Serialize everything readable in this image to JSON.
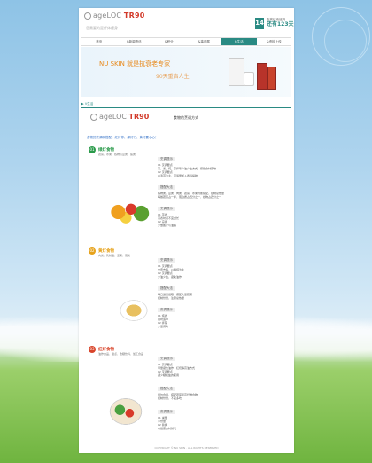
{
  "brand": {
    "logo_text": "ageLOC",
    "logo_tr": "TR90",
    "tagline": "您需要的是纤体瘦身"
  },
  "day_counter": {
    "day": "14",
    "label": "距离结束还剩",
    "remaining": "还有123天"
  },
  "nav": {
    "items": [
      {
        "label": "首页"
      },
      {
        "label": "&新闻资讯"
      },
      {
        "label": "&积分"
      },
      {
        "label": "&事迹展"
      },
      {
        "label": "&生活"
      },
      {
        "label": "&资料上传"
      }
    ],
    "active_index": 4
  },
  "banner": {
    "headline": "NU SKIN 就是抗衰老专家",
    "subline": "90天重启人生"
  },
  "breadcrumb": {
    "text": "V生活"
  },
  "content": {
    "title_logo": "ageLOC",
    "title_tr": "TR90",
    "heading": "食物的烹调方式",
    "intro": "食物的烹调和搭配，红灯停、绿灯行、黄灯要小心！",
    "sections": [
      {
        "num": "01",
        "title": "绿灯食物",
        "desc": "蔬菜、水果、谷物与豆类、鱼类",
        "color": "#2a9a4a",
        "col1_tag": "烹调提示",
        "col1_lines": [
          "01 烹调要点",
          "蒸、煮、炖、凉拌等少油少盐方式，保留食材原味",
          "02 烹调要点",
          "以清蒸为主、可适量加入香料提味"
        ],
        "col2_tag": "搭配大法",
        "col2_lines": [
          "谷物类、豆类、肉类、蔬菜、水果均衡搭配，控制总热量",
          "每餐蔬菜占一半、蛋白质占四分之一、谷物占四分之一"
        ],
        "col3_tag": "烹调提示",
        "col3_lines": [
          "01 蒸煮",
          "蒸煮时间不宜过长",
          "02 凉拌",
          "少放酱汁与油脂"
        ]
      },
      {
        "num": "02",
        "title": "黄灯食物",
        "desc": "肉类、乳制品、坚果、蛋类",
        "color": "#e6a21a",
        "col1_tag": "烹调提示",
        "col1_lines": [
          "01 烹调要点",
          "去皮去脂、以烤炖为主",
          "02 烹调要点",
          "少油少盐，避免油炸"
        ],
        "col2_tag": "搭配大法",
        "col2_lines": [
          "每日适量摄取，搭配大量蔬菜",
          "控制份量，注意总热量"
        ],
        "col3_tag": "烹调提示",
        "col3_lines": [
          "01 炖煮",
          "用时适中",
          "02 拌菜",
          "少量调味"
        ]
      },
      {
        "num": "03",
        "title": "红灯食物",
        "desc": "油炸食品、甜点、含糖饮料、加工食品",
        "color": "#d8442a",
        "col1_tag": "烹调提示",
        "col1_lines": [
          "01 烹调要点",
          "尽量避免油炸、红烧等高油方式",
          "02 烹调要点",
          "减少糖和盐的使用"
        ],
        "col2_tag": "搭配大法",
        "col2_lines": [
          "偶尔食用，搭配蔬菜和高纤维食物",
          "控制份量，不宜多吃"
        ],
        "col3_tag": "烹调提示",
        "col3_lines": [
          "01 减量",
          "小份量",
          "02 替换",
          "以健康食材替代"
        ]
      }
    ]
  },
  "footer": {
    "text": "COPYRIGHT © NU SKIN · ALL RIGHTS RESERVED"
  },
  "colors": {
    "accent": "#2a8a83",
    "orange": "#e8891b"
  }
}
